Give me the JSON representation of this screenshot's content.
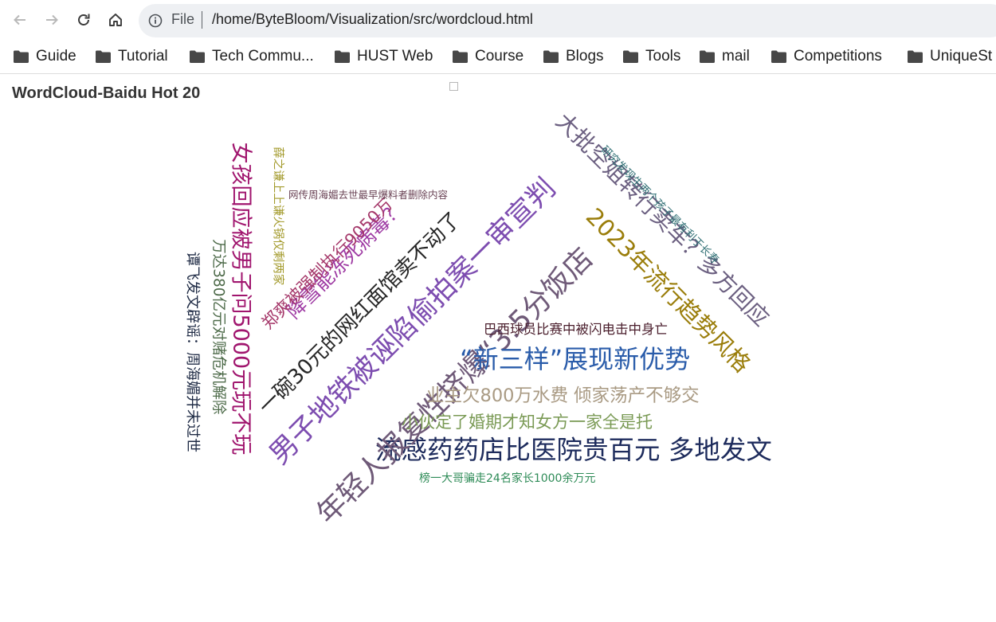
{
  "browser": {
    "scheme_label": "File",
    "url": "/home/ByteBloom/Visualization/src/wordcloud.html",
    "bookmarks": [
      "Guide",
      "Tutorial",
      "Tech Commu...",
      "HUST Web",
      "Course",
      "Blogs",
      "Tools",
      "mail",
      "Competitions",
      "UniqueSt"
    ]
  },
  "page": {
    "title": "WordCloud-Baidu Hot 20"
  },
  "words": [
    {
      "text": "流感药药店比医院贵百元 多地发文",
      "color": "#1d2b5c"
    },
    {
      "text": "年轻人报复性挤爆“3.5分饭店",
      "color": "#6f5a78"
    },
    {
      "text": "男子地铁被诬陷偷拍案一审宣判",
      "color": "#7d4db0"
    },
    {
      "text": "一碗30元的网红面馆卖不动了",
      "color": "#262626"
    },
    {
      "text": "“新三样”展现新优势",
      "color": "#2a5caa"
    },
    {
      "text": "大批空姐转行卖车？多方回应",
      "color": "#6b5f80"
    },
    {
      "text": "2023年流行趋势风格",
      "color": "#9a7d0a"
    },
    {
      "text": "女孩回应被男子问5000元玩不玩",
      "color": "#a0156e"
    },
    {
      "text": "降雪能冻死病毒？",
      "color": "#9e3aa3"
    },
    {
      "text": "业主欠800万水费 倾家荡产不够交",
      "color": "#a99a83"
    },
    {
      "text": "小伙定了婚期才知女方一家全是托",
      "color": "#7a9a55"
    },
    {
      "text": "巴西球员比赛中被闪电击中身亡",
      "color": "#4a1e2c"
    },
    {
      "text": "郑爽被强制执行9050万",
      "color": "#a5386a"
    },
    {
      "text": "万达380亿元对赌危机解除",
      "color": "#4e6b4a"
    },
    {
      "text": "谭飞发文辟谣：周海媚并未过世",
      "color": "#1e2a44"
    },
    {
      "text": "薛之谦上上谦火锅仅剩两家",
      "color": "#a39a2b"
    },
    {
      "text": "研究发现生两个孩子最有利于长寿",
      "color": "#2e6e73"
    },
    {
      "text": "网传周海媚去世最早爆料者删除内容",
      "color": "#6b4456"
    },
    {
      "text": "榜一大哥骗走24名家长1000余万元",
      "color": "#2e8b57"
    }
  ]
}
